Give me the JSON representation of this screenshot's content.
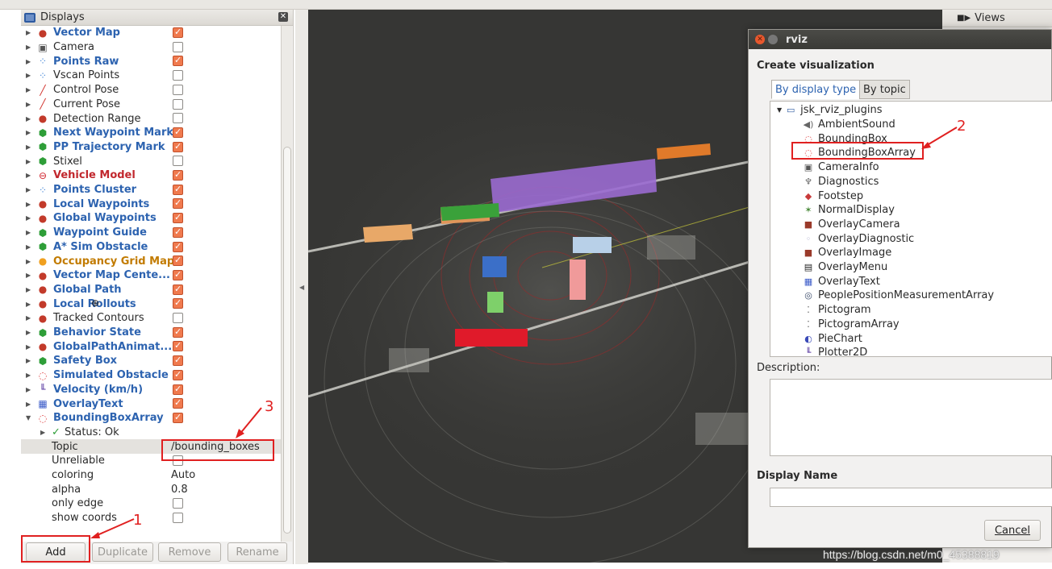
{
  "displays_panel": {
    "title": "Displays",
    "items": [
      {
        "label": "Vector Map",
        "style": "b",
        "checked": true,
        "icon": "multi-dot-icon"
      },
      {
        "label": "Camera",
        "style": "",
        "checked": false,
        "icon": "camera-icon"
      },
      {
        "label": "Points Raw",
        "style": "b",
        "checked": true,
        "icon": "points-icon"
      },
      {
        "label": "Vscan Points",
        "style": "",
        "checked": false,
        "icon": "points-icon"
      },
      {
        "label": "Control Pose",
        "style": "",
        "checked": false,
        "icon": "pose-arrow-icon"
      },
      {
        "label": "Current Pose",
        "style": "",
        "checked": false,
        "icon": "pose-arrow-icon"
      },
      {
        "label": "Detection Range",
        "style": "",
        "checked": false,
        "icon": "multi-dot-icon"
      },
      {
        "label": "Next Waypoint Mark",
        "style": "b",
        "checked": true,
        "icon": "green-cube-icon"
      },
      {
        "label": "PP Trajectory Mark",
        "style": "b",
        "checked": true,
        "icon": "green-cube-icon"
      },
      {
        "label": "Stixel",
        "style": "",
        "checked": false,
        "icon": "green-cube-icon"
      },
      {
        "label": "Vehicle Model",
        "style": "red",
        "checked": true,
        "icon": "error-icon"
      },
      {
        "label": "Points Cluster",
        "style": "b",
        "checked": true,
        "icon": "points-icon"
      },
      {
        "label": "Local Waypoints",
        "style": "b",
        "checked": true,
        "icon": "multi-dot-icon"
      },
      {
        "label": "Global Waypoints",
        "style": "b",
        "checked": true,
        "icon": "multi-dot-icon"
      },
      {
        "label": "Waypoint Guide",
        "style": "b",
        "checked": true,
        "icon": "green-cube-icon"
      },
      {
        "label": "A* Sim Obstacle",
        "style": "b",
        "checked": true,
        "icon": "green-cube-icon"
      },
      {
        "label": "Occupancy Grid Map",
        "style": "amber",
        "checked": true,
        "icon": "warning-icon"
      },
      {
        "label": "Vector Map Cente...",
        "style": "b",
        "checked": true,
        "icon": "multi-dot-icon"
      },
      {
        "label": "Global Path",
        "style": "b",
        "checked": true,
        "icon": "multi-dot-icon"
      },
      {
        "label": "Local Rollouts",
        "style": "b",
        "checked": true,
        "icon": "multi-dot-icon"
      },
      {
        "label": "Tracked Contours",
        "style": "",
        "checked": false,
        "icon": "multi-dot-icon"
      },
      {
        "label": "Behavior State",
        "style": "b",
        "checked": true,
        "icon": "green-cube-icon"
      },
      {
        "label": "GlobalPathAnimat...",
        "style": "b",
        "checked": true,
        "icon": "multi-dot-icon"
      },
      {
        "label": "Safety Box",
        "style": "b",
        "checked": true,
        "icon": "green-cube-icon"
      },
      {
        "label": "Simulated Obstacle",
        "style": "b",
        "checked": true,
        "icon": "bbox-icon"
      },
      {
        "label": "Velocity (km/h)",
        "style": "b",
        "checked": true,
        "icon": "plot-icon"
      },
      {
        "label": "OverlayText",
        "style": "b",
        "checked": true,
        "icon": "overlay-text-icon"
      },
      {
        "label": "BoundingBoxArray",
        "style": "b",
        "checked": true,
        "icon": "bbox-icon",
        "expanded": true
      }
    ],
    "status": "Status: Ok",
    "properties": [
      {
        "label": "Topic",
        "value": "/bounding_boxes",
        "kind": "text"
      },
      {
        "label": "Unreliable",
        "value": "",
        "kind": "checkbox",
        "checked": false
      },
      {
        "label": "coloring",
        "value": "Auto",
        "kind": "text"
      },
      {
        "label": "alpha",
        "value": "0.8",
        "kind": "text"
      },
      {
        "label": "only edge",
        "value": "",
        "kind": "checkbox",
        "checked": false
      },
      {
        "label": "show coords",
        "value": "",
        "kind": "checkbox",
        "checked": false
      }
    ],
    "buttons": {
      "add": "Add",
      "duplicate": "Duplicate",
      "remove": "Remove",
      "rename": "Rename"
    }
  },
  "views_panel": {
    "title": "Views"
  },
  "dialog": {
    "title": "rviz",
    "heading": "Create visualization",
    "tabs": [
      "By display type",
      "By topic"
    ],
    "root": "jsk_rviz_plugins",
    "plugins": [
      {
        "label": "AmbientSound",
        "icon": "sound-icon"
      },
      {
        "label": "BoundingBox",
        "icon": "bbox-icon"
      },
      {
        "label": "BoundingBoxArray",
        "icon": "bbox-icon"
      },
      {
        "label": "CameraInfo",
        "icon": "camera-icon"
      },
      {
        "label": "Diagnostics",
        "icon": "diagnostics-icon"
      },
      {
        "label": "Footstep",
        "icon": "footstep-icon"
      },
      {
        "label": "NormalDisplay",
        "icon": "normal-icon"
      },
      {
        "label": "OverlayCamera",
        "icon": "overlay-camera-icon"
      },
      {
        "label": "OverlayDiagnostic",
        "icon": "blank-icon"
      },
      {
        "label": "OverlayImage",
        "icon": "overlay-image-icon"
      },
      {
        "label": "OverlayMenu",
        "icon": "overlay-menu-icon"
      },
      {
        "label": "OverlayText",
        "icon": "overlay-text-icon"
      },
      {
        "label": "PeoplePositionMeasurementArray",
        "icon": "people-icon"
      },
      {
        "label": "Pictogram",
        "icon": "pictogram-icon"
      },
      {
        "label": "PictogramArray",
        "icon": "pictogram-icon"
      },
      {
        "label": "PieChart",
        "icon": "pie-icon"
      },
      {
        "label": "Plotter2D",
        "icon": "plot-icon"
      }
    ],
    "description_label": "Description:",
    "display_name_label": "Display Name",
    "cancel": "Cancel"
  },
  "annotations": {
    "n1": "1",
    "n2": "2",
    "n3": "3"
  },
  "watermark": "https://blog.csdn.net/m0_45388819"
}
